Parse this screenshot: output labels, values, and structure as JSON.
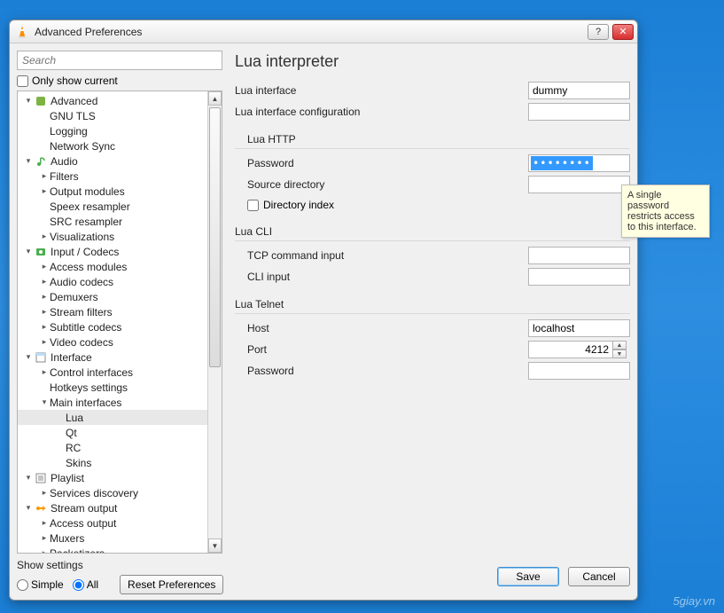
{
  "window": {
    "title": "Advanced Preferences"
  },
  "search": {
    "placeholder": "Search"
  },
  "only_current_label": "Only show current",
  "tree": [
    {
      "depth": 0,
      "tw": "▾",
      "icon": "gear-green",
      "label": "Advanced"
    },
    {
      "depth": 1,
      "tw": "",
      "icon": "",
      "label": "GNU TLS"
    },
    {
      "depth": 1,
      "tw": "",
      "icon": "",
      "label": "Logging"
    },
    {
      "depth": 1,
      "tw": "",
      "icon": "",
      "label": "Network Sync"
    },
    {
      "depth": 0,
      "tw": "▾",
      "icon": "audio",
      "label": "Audio"
    },
    {
      "depth": 1,
      "tw": "▸",
      "icon": "",
      "label": "Filters"
    },
    {
      "depth": 1,
      "tw": "▸",
      "icon": "",
      "label": "Output modules"
    },
    {
      "depth": 1,
      "tw": "",
      "icon": "",
      "label": "Speex resampler"
    },
    {
      "depth": 1,
      "tw": "",
      "icon": "",
      "label": "SRC resampler"
    },
    {
      "depth": 1,
      "tw": "▸",
      "icon": "",
      "label": "Visualizations"
    },
    {
      "depth": 0,
      "tw": "▾",
      "icon": "codecs",
      "label": "Input / Codecs"
    },
    {
      "depth": 1,
      "tw": "▸",
      "icon": "",
      "label": "Access modules"
    },
    {
      "depth": 1,
      "tw": "▸",
      "icon": "",
      "label": "Audio codecs"
    },
    {
      "depth": 1,
      "tw": "▸",
      "icon": "",
      "label": "Demuxers"
    },
    {
      "depth": 1,
      "tw": "▸",
      "icon": "",
      "label": "Stream filters"
    },
    {
      "depth": 1,
      "tw": "▸",
      "icon": "",
      "label": "Subtitle codecs"
    },
    {
      "depth": 1,
      "tw": "▸",
      "icon": "",
      "label": "Video codecs"
    },
    {
      "depth": 0,
      "tw": "▾",
      "icon": "interface",
      "label": "Interface"
    },
    {
      "depth": 1,
      "tw": "▸",
      "icon": "",
      "label": "Control interfaces"
    },
    {
      "depth": 1,
      "tw": "",
      "icon": "",
      "label": "Hotkeys settings"
    },
    {
      "depth": 1,
      "tw": "▾",
      "icon": "",
      "label": "Main interfaces"
    },
    {
      "depth": 2,
      "tw": "",
      "icon": "",
      "label": "Lua",
      "selected": true
    },
    {
      "depth": 2,
      "tw": "",
      "icon": "",
      "label": "Qt"
    },
    {
      "depth": 2,
      "tw": "",
      "icon": "",
      "label": "RC"
    },
    {
      "depth": 2,
      "tw": "",
      "icon": "",
      "label": "Skins"
    },
    {
      "depth": 0,
      "tw": "▾",
      "icon": "playlist",
      "label": "Playlist"
    },
    {
      "depth": 1,
      "tw": "▸",
      "icon": "",
      "label": "Services discovery"
    },
    {
      "depth": 0,
      "tw": "▾",
      "icon": "stream",
      "label": "Stream output"
    },
    {
      "depth": 1,
      "tw": "▸",
      "icon": "",
      "label": "Access output"
    },
    {
      "depth": 1,
      "tw": "▸",
      "icon": "",
      "label": "Muxers"
    },
    {
      "depth": 1,
      "tw": "▸",
      "icon": "",
      "label": "Packetizers"
    }
  ],
  "panel": {
    "title": "Lua interpreter",
    "lua_interface_label": "Lua interface",
    "lua_interface_value": "dummy",
    "lua_config_label": "Lua interface configuration",
    "lua_config_value": "",
    "http_group": "Lua HTTP",
    "http_password_label": "Password",
    "http_password_value": "••••••••",
    "http_srcdir_label": "Source directory",
    "http_srcdir_value": "",
    "http_dirindex_label": "Directory index",
    "cli_group": "Lua CLI",
    "cli_tcp_label": "TCP command input",
    "cli_tcp_value": "",
    "cli_input_label": "CLI input",
    "cli_input_value": "",
    "telnet_group": "Lua Telnet",
    "telnet_host_label": "Host",
    "telnet_host_value": "localhost",
    "telnet_port_label": "Port",
    "telnet_port_value": "4212",
    "telnet_password_label": "Password",
    "telnet_password_value": ""
  },
  "footer": {
    "show_settings_label": "Show settings",
    "simple_label": "Simple",
    "all_label": "All",
    "reset_label": "Reset Preferences",
    "save_label": "Save",
    "cancel_label": "Cancel"
  },
  "tooltip": "A single password restricts access to this interface.",
  "watermark": "5giay.vn"
}
